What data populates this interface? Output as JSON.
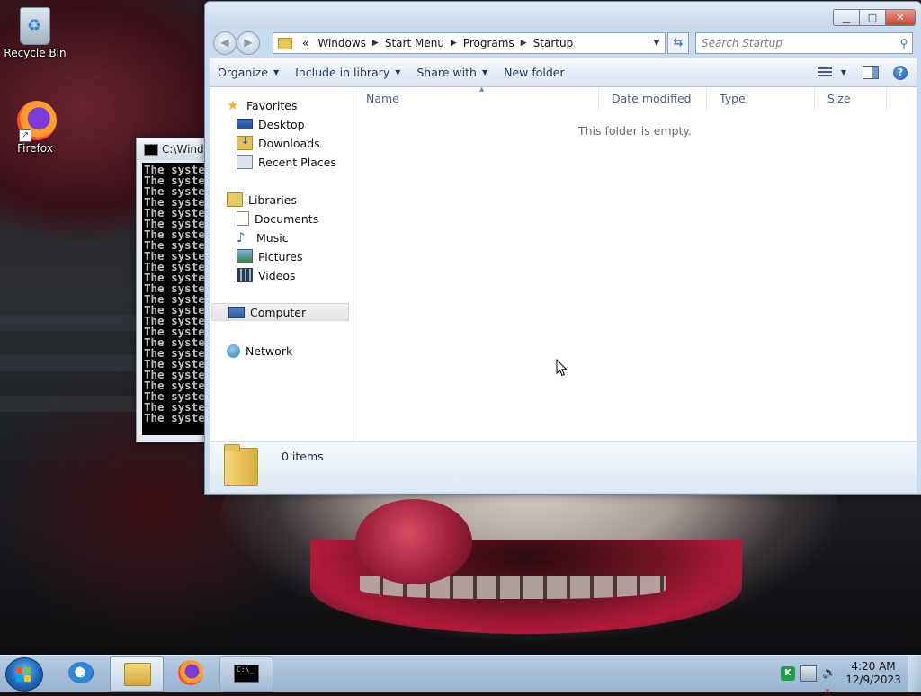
{
  "desktop": {
    "icons": [
      {
        "label": "Recycle Bin",
        "icon": "recycle-bin-icon"
      },
      {
        "label": "Firefox",
        "icon": "firefox-icon"
      }
    ]
  },
  "cmd_window": {
    "title": "C:\\Windo",
    "lines": [
      "The syste",
      "The syste",
      "The syste",
      "The syste",
      "The syste",
      "The syste",
      "The syste",
      "The syste",
      "The syste",
      "The syste",
      "The syste",
      "The syste",
      "The syste",
      "The syste",
      "The syste",
      "The syste",
      "The syste",
      "The syste",
      "The syste",
      "The syste",
      "The syste",
      "The syste",
      "The syste",
      "The syste"
    ]
  },
  "explorer": {
    "breadcrumb_overflow": "«",
    "breadcrumb": [
      "Windows",
      "Start Menu",
      "Programs",
      "Startup"
    ],
    "search_placeholder": "Search Startup",
    "toolbar": {
      "organize": "Organize",
      "include_in_library": "Include in library",
      "share_with": "Share with",
      "new_folder": "New folder"
    },
    "nav": {
      "favorites": "Favorites",
      "desktop": "Desktop",
      "downloads": "Downloads",
      "recent_places": "Recent Places",
      "libraries": "Libraries",
      "documents": "Documents",
      "music": "Music",
      "pictures": "Pictures",
      "videos": "Videos",
      "computer": "Computer",
      "network": "Network"
    },
    "columns": {
      "name": "Name",
      "date_modified": "Date modified",
      "type": "Type",
      "size": "Size"
    },
    "empty_message": "This folder is empty.",
    "status": "0 items"
  },
  "taskbar": {
    "pinned": [
      "internet-explorer",
      "windows-explorer",
      "firefox",
      "command-prompt"
    ],
    "active": "windows-explorer",
    "clock_time": "4:20 AM",
    "clock_date": "12/9/2023"
  },
  "colors": {
    "selection_bg": "#e4e4e4",
    "explorer_frame": "#c9dcef",
    "toolbar_text": "#1e395b",
    "close_button": "#c7442f"
  }
}
